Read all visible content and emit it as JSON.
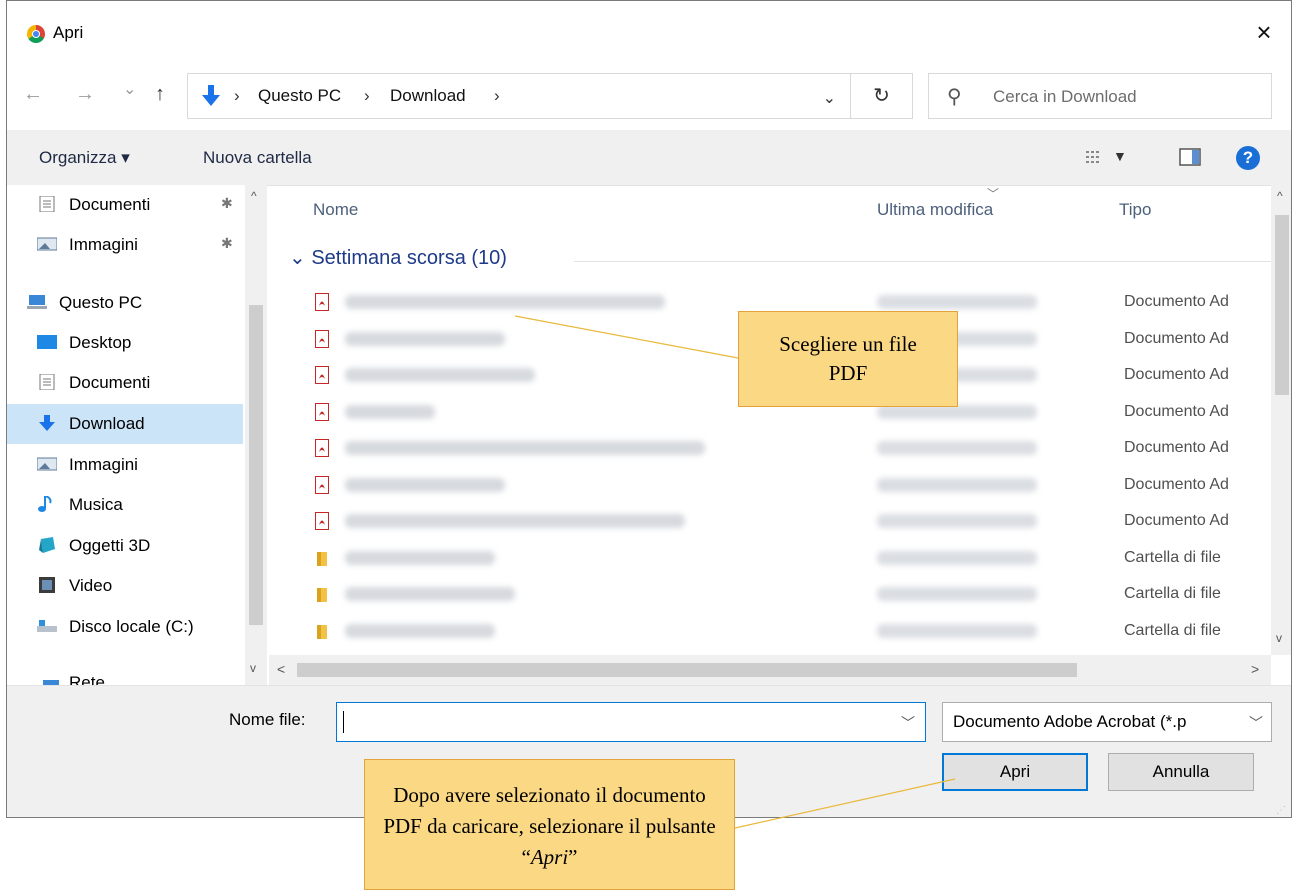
{
  "window": {
    "title": "Apri",
    "close_glyph": "×"
  },
  "nav": {
    "back": "←",
    "forward": "→",
    "recent": "⌄",
    "up": "↑"
  },
  "address": {
    "crumbs": [
      "Questo PC",
      "Download"
    ],
    "separator": "›",
    "dropdown": "⌄",
    "refresh": "↻"
  },
  "search": {
    "placeholder": "Cerca in Download"
  },
  "toolbar": {
    "organize": "Organizza ▾",
    "new_folder": "Nuova cartella",
    "help": "?"
  },
  "sidebar": {
    "items": [
      {
        "label": "Documenti",
        "icon": "document-icon",
        "pinned": true
      },
      {
        "label": "Immagini",
        "icon": "pictures-icon",
        "pinned": true
      },
      {
        "label": "Questo PC",
        "icon": "computer-icon"
      },
      {
        "label": "Desktop",
        "icon": "desktop-icon"
      },
      {
        "label": "Documenti",
        "icon": "document-icon"
      },
      {
        "label": "Download",
        "icon": "download-icon",
        "selected": true
      },
      {
        "label": "Immagini",
        "icon": "pictures-icon"
      },
      {
        "label": "Musica",
        "icon": "music-icon"
      },
      {
        "label": "Oggetti 3D",
        "icon": "3d-objects-icon"
      },
      {
        "label": "Video",
        "icon": "video-icon"
      },
      {
        "label": "Disco locale (C:)",
        "icon": "drive-icon"
      },
      {
        "label": "Rete",
        "icon": "network-icon"
      }
    ]
  },
  "columns": {
    "name": "Nome",
    "modified": "Ultima modifica",
    "type": "Tipo"
  },
  "group": {
    "label": "Settimana scorsa (10)",
    "chevron": "⌄"
  },
  "files": [
    {
      "type": "Documento Ad",
      "icon": "pdf-icon"
    },
    {
      "type": "Documento Ad",
      "icon": "pdf-icon"
    },
    {
      "type": "Documento Ad",
      "icon": "pdf-icon"
    },
    {
      "type": "Documento Ad",
      "icon": "pdf-icon"
    },
    {
      "type": "Documento Ad",
      "icon": "pdf-icon"
    },
    {
      "type": "Documento Ad",
      "icon": "pdf-icon"
    },
    {
      "type": "Documento Ad",
      "icon": "pdf-icon"
    },
    {
      "type": "Cartella di file",
      "icon": "folder-icon"
    },
    {
      "type": "Cartella di file",
      "icon": "folder-icon"
    },
    {
      "type": "Cartella di file",
      "icon": "folder-icon"
    }
  ],
  "bottom": {
    "filename_label": "Nome file:",
    "filename_value": "",
    "filter": "Documento Adobe Acrobat (*.p",
    "open_button": "Apri",
    "cancel_button": "Annulla"
  },
  "callouts": {
    "choose_pdf": "Scegliere un file PDF",
    "open_hint_prefix": "Dopo avere selezionato il documento PDF da caricare, selezionare il pulsante “",
    "open_hint_em": "Apri",
    "open_hint_suffix": "”"
  }
}
